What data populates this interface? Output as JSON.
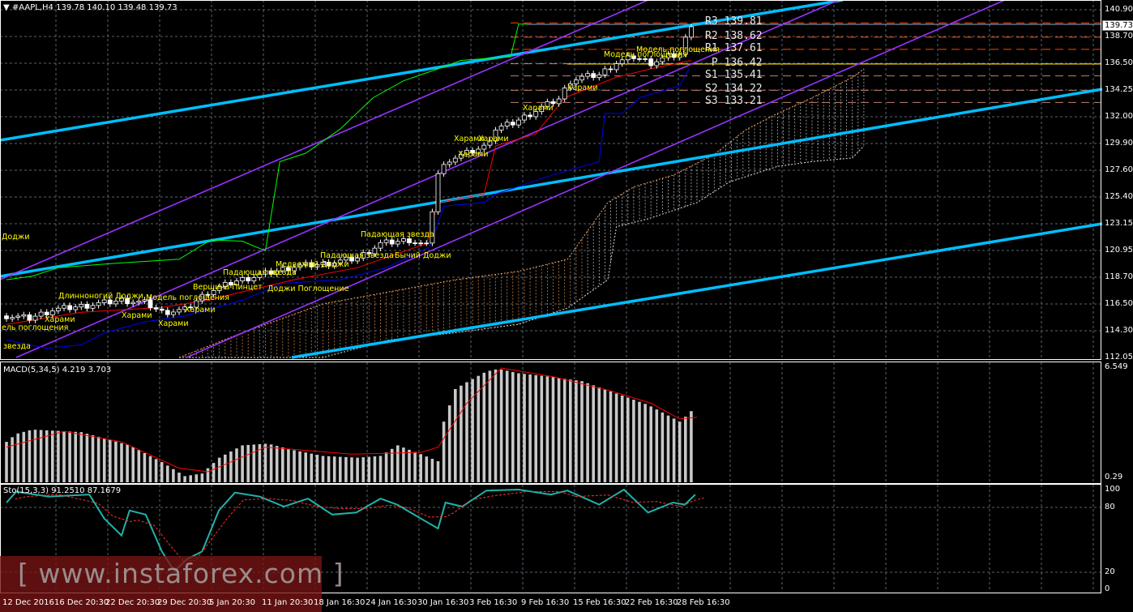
{
  "header": {
    "symbol": "#AAPL,H4",
    "ohlc": "139.78 140.10 139.48 139.73"
  },
  "current_price": "139.73",
  "macd_label": "MACD(5,34,5) 4.219 3.703",
  "stoch_label": "Sto(15,3,3) 91.2510 87.1679",
  "watermark": "[ www.instaforex.com ]",
  "pivots": [
    {
      "name": "R3",
      "value": "139.81"
    },
    {
      "name": "R2",
      "value": "138.62"
    },
    {
      "name": "R1",
      "value": "137.61"
    },
    {
      "name": " P",
      "value": "136.42"
    },
    {
      "name": "S1",
      "value": "135.41"
    },
    {
      "name": "S2",
      "value": "134.22"
    },
    {
      "name": "S3",
      "value": "133.21"
    }
  ],
  "price_axis": [
    "140.90",
    "138.70",
    "136.50",
    "134.25",
    "132.00",
    "129.90",
    "127.60",
    "125.40",
    "123.15",
    "120.95",
    "118.70",
    "116.50",
    "114.30",
    "112.05"
  ],
  "macd_axis": [
    "6.549",
    "0.29"
  ],
  "stoch_axis": [
    "100",
    "80",
    "20",
    "0"
  ],
  "time_axis": [
    "12 Dec 2016",
    "16 Dec 20:30",
    "22 Dec 20:30",
    "29 Dec 20:30",
    "5 Jan 20:30",
    "11 Jan 20:30",
    "18 Jan 16:30",
    "24 Jan 16:30",
    "30 Jan 16:30",
    "3 Feb 16:30",
    "9 Feb 16:30",
    "15 Feb 16:30",
    "22 Feb 16:30",
    "28 Feb 16:30"
  ],
  "patterns": [
    {
      "text": "Доджи"
    },
    {
      "text": "Харами"
    },
    {
      "text": "ель поглощения"
    },
    {
      "text": "Длинноногий Доджи"
    },
    {
      "text": "Модель поглощения"
    },
    {
      "text": "Харами"
    },
    {
      "text": "Харами"
    },
    {
      "text": "Харами"
    },
    {
      "text": "Вершина Пинцет"
    },
    {
      "text": "Падающая звезда"
    },
    {
      "text": "Доджи Поглощение"
    },
    {
      "text": "Медвежий Доджи"
    },
    {
      "text": "Падающая звезда"
    },
    {
      "text": "Падающая звезда"
    },
    {
      "text": "Бычий Доджи"
    },
    {
      "text": "Харами"
    },
    {
      "text": "Харами"
    },
    {
      "text": "Харами"
    },
    {
      "text": "Харами"
    },
    {
      "text": "Модель поглощения"
    },
    {
      "text": "Модель поглощения"
    },
    {
      "text": "Харами"
    },
    {
      "text": "звезда"
    }
  ],
  "colors": {
    "bg": "#000000",
    "grid": "#5a6470",
    "kijun": "#0000ff",
    "tenkan": "#ff0000",
    "chikou": "#00ff00",
    "trend_cyan": "#00bfff",
    "channel": "#9933ff",
    "pivot": "#ff4500",
    "pivot_p": "#ffd700",
    "cloud": "#f4a460",
    "stoch": "#20b2aa"
  },
  "chart_data": {
    "type": "candlestick",
    "title": "#AAPL,H4",
    "ylim": [
      112.05,
      140.9
    ],
    "close": [
      [
        0,
        115.5
      ],
      [
        4,
        115.3
      ],
      [
        8,
        116
      ],
      [
        13,
        116.3
      ],
      [
        20,
        116.8
      ],
      [
        24,
        116.6
      ],
      [
        27,
        115.8
      ],
      [
        31,
        116
      ],
      [
        35,
        117.5
      ],
      [
        40,
        118.4
      ],
      [
        45,
        119
      ],
      [
        50,
        119.6
      ],
      [
        55,
        119.8
      ],
      [
        61,
        120.3
      ],
      [
        65,
        121.5
      ],
      [
        70,
        121.8
      ],
      [
        73,
        121.3
      ],
      [
        75,
        127.3
      ],
      [
        77,
        128.5
      ],
      [
        80,
        129
      ],
      [
        83,
        129.5
      ],
      [
        85,
        131
      ],
      [
        88,
        131.5
      ],
      [
        90,
        132
      ],
      [
        93,
        132.8
      ],
      [
        96,
        133.5
      ],
      [
        98,
        135
      ],
      [
        100,
        135.3
      ],
      [
        103,
        135.5
      ],
      [
        106,
        136.5
      ],
      [
        109,
        137
      ],
      [
        112,
        136.5
      ],
      [
        115,
        137
      ],
      [
        117,
        137.2
      ],
      [
        119,
        139.73
      ]
    ],
    "tenkan": [
      [
        0,
        114.8
      ],
      [
        13,
        115.8
      ],
      [
        27,
        116.2
      ],
      [
        35,
        116.8
      ],
      [
        41,
        117.5
      ],
      [
        50,
        118.5
      ],
      [
        61,
        119.5
      ],
      [
        73,
        121.5
      ],
      [
        75,
        124.9
      ],
      [
        83,
        125.6
      ],
      [
        85,
        129.6
      ],
      [
        92,
        130.6
      ],
      [
        97,
        133.6
      ],
      [
        106,
        135.3
      ],
      [
        112,
        136
      ],
      [
        119,
        136.7
      ]
    ],
    "kijun": [
      [
        0,
        113.5
      ],
      [
        7,
        112.8
      ],
      [
        13,
        113.1
      ],
      [
        17,
        114.1
      ],
      [
        24,
        115
      ],
      [
        31,
        115.5
      ],
      [
        41,
        116.8
      ],
      [
        48,
        118.2
      ],
      [
        58,
        118.5
      ],
      [
        66,
        119.5
      ],
      [
        73.5,
        121.2
      ],
      [
        76,
        124.6
      ],
      [
        83,
        124.9
      ],
      [
        85,
        125.6
      ],
      [
        95,
        127.2
      ],
      [
        103,
        128.3
      ],
      [
        104,
        132.3
      ],
      [
        107,
        132.3
      ],
      [
        110,
        133.6
      ],
      [
        117,
        134.6
      ],
      [
        118.6,
        136
      ]
    ],
    "chikou": [
      [
        0,
        118.5
      ],
      [
        4.5,
        118.8
      ],
      [
        9,
        119.5
      ],
      [
        18.6,
        119.85
      ],
      [
        30,
        120.2
      ],
      [
        35.5,
        121.8
      ],
      [
        41,
        121.7
      ],
      [
        45,
        120.9
      ],
      [
        47.5,
        128.3
      ],
      [
        52,
        129
      ],
      [
        58,
        131
      ],
      [
        63.7,
        133.6
      ],
      [
        69,
        135
      ],
      [
        75,
        136
      ],
      [
        79,
        136.7
      ],
      [
        87.6,
        137
      ],
      [
        89,
        139.7
      ],
      [
        90.5,
        139.7
      ]
    ],
    "cloud_upper": [
      [
        30,
        112.05
      ],
      [
        41,
        114.1
      ],
      [
        55,
        116.5
      ],
      [
        66.5,
        117.5
      ],
      [
        78,
        118.5
      ],
      [
        89,
        119.2
      ],
      [
        97.5,
        120.2
      ],
      [
        104.5,
        124.9
      ],
      [
        109,
        126.2
      ],
      [
        116,
        127.2
      ],
      [
        123,
        128.9
      ],
      [
        128.5,
        130.95
      ],
      [
        134,
        132.3
      ],
      [
        140,
        133.6
      ],
      [
        147,
        135.3
      ],
      [
        149,
        136
      ]
    ],
    "cloud_lower": [
      [
        30,
        112.05
      ],
      [
        55,
        112.05
      ],
      [
        66.5,
        113.5
      ],
      [
        78,
        114.1
      ],
      [
        89,
        114.8
      ],
      [
        97.5,
        116.15
      ],
      [
        104.5,
        118.5
      ],
      [
        106,
        122.9
      ],
      [
        111.5,
        123.55
      ],
      [
        120,
        124.9
      ],
      [
        125.6,
        126.6
      ],
      [
        134,
        127.9
      ],
      [
        140,
        128.3
      ],
      [
        147,
        128.6
      ],
      [
        149,
        129.6
      ]
    ],
    "macd": {
      "ylim": [
        0,
        6.549
      ],
      "histogram": [
        [
          0,
          2.3
        ],
        [
          1.7,
          2.75
        ],
        [
          4.5,
          3
        ],
        [
          13,
          2.85
        ],
        [
          17,
          2.5
        ],
        [
          21.4,
          2.1
        ],
        [
          27,
          1.15
        ],
        [
          31,
          0.35
        ],
        [
          34,
          0.5
        ],
        [
          37,
          1.4
        ],
        [
          41,
          2.1
        ],
        [
          45.4,
          2.2
        ],
        [
          49.6,
          1.85
        ],
        [
          55,
          1.5
        ],
        [
          61,
          1.4
        ],
        [
          65,
          1.5
        ],
        [
          68,
          2.1
        ],
        [
          72,
          1.6
        ],
        [
          75,
          1.2
        ],
        [
          76,
          3.45
        ],
        [
          78,
          5.3
        ],
        [
          80.3,
          5.75
        ],
        [
          83.4,
          6.3
        ],
        [
          85.5,
          6.45
        ],
        [
          89,
          6.2
        ],
        [
          94.6,
          6.0
        ],
        [
          100,
          5.75
        ],
        [
          106,
          5.05
        ],
        [
          111.5,
          4.4
        ],
        [
          117,
          3.45
        ],
        [
          118.6,
          3.9
        ],
        [
          119.7,
          4.3
        ]
      ],
      "signal": [
        [
          0,
          2
        ],
        [
          10,
          2.9
        ],
        [
          20,
          2.3
        ],
        [
          30,
          0.8
        ],
        [
          35,
          0.6
        ],
        [
          45,
          2
        ],
        [
          60,
          1.6
        ],
        [
          72,
          1.7
        ],
        [
          75,
          2
        ],
        [
          80,
          4.5
        ],
        [
          86,
          6.5
        ],
        [
          95,
          6
        ],
        [
          105,
          5.2
        ],
        [
          112,
          4.5
        ],
        [
          117,
          3.6
        ],
        [
          120,
          3.7
        ]
      ]
    },
    "stochastic": {
      "ylim": [
        0,
        100
      ],
      "levels": [
        20,
        80
      ],
      "main": [
        [
          0,
          87
        ],
        [
          1.7,
          98
        ],
        [
          7.3,
          93
        ],
        [
          14.4,
          95
        ],
        [
          17,
          71
        ],
        [
          20,
          54
        ],
        [
          21.4,
          79
        ],
        [
          24.2,
          75
        ],
        [
          27,
          38
        ],
        [
          29.2,
          18
        ],
        [
          31.3,
          30
        ],
        [
          34,
          38
        ],
        [
          36.9,
          79
        ],
        [
          39.7,
          97
        ],
        [
          44,
          93
        ],
        [
          48.2,
          83
        ],
        [
          52.4,
          91
        ],
        [
          56.6,
          75
        ],
        [
          60.8,
          77
        ],
        [
          65,
          91
        ],
        [
          67.9,
          85
        ],
        [
          72,
          71
        ],
        [
          75,
          61
        ],
        [
          76.3,
          87
        ],
        [
          79.2,
          83
        ],
        [
          83.4,
          99
        ],
        [
          89,
          100
        ],
        [
          94.6,
          95
        ],
        [
          97.5,
          99
        ],
        [
          103,
          85
        ],
        [
          107.3,
          100
        ],
        [
          111.5,
          77
        ],
        [
          115.8,
          87
        ],
        [
          117.9,
          85
        ],
        [
          119.7,
          95
        ]
      ]
    }
  }
}
